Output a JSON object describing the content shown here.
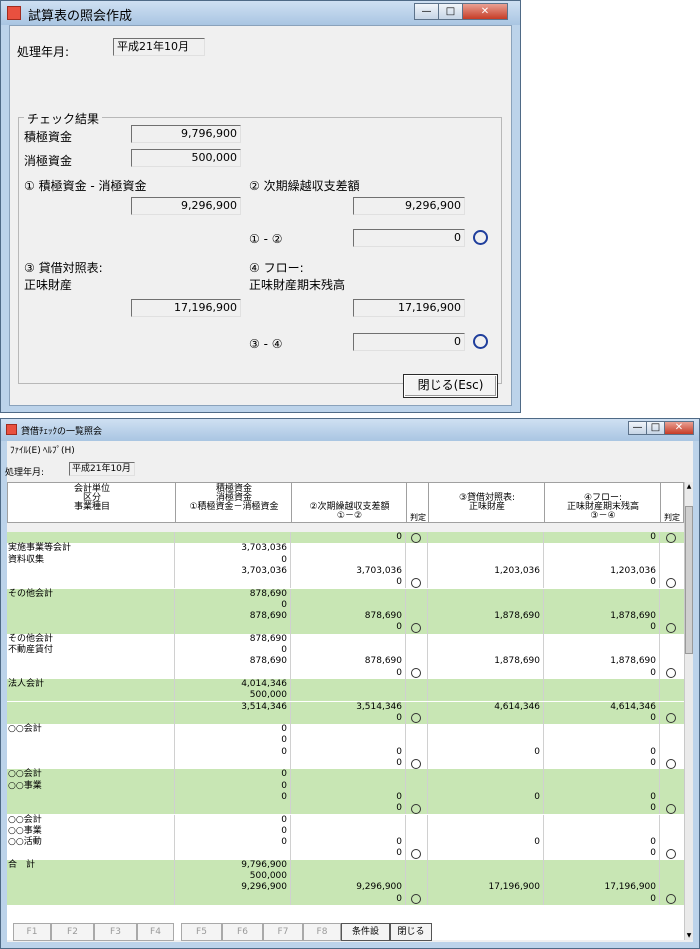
{
  "dialog": {
    "title": "試算表の照会作成",
    "period_label": "処理年月:",
    "period_value": "平成21年10月",
    "group_title": "チェック結果",
    "rows": {
      "positive_label": "積極資金",
      "positive_value": "9,796,900",
      "negative_label": "消極資金",
      "negative_value": "500,000",
      "item1_label": "① 積極資金 - 消極資金",
      "item1_value": "9,296,900",
      "item2_label": "② 次期繰越収支差額",
      "item2_value": "9,296,900",
      "diff12_label": "① - ②",
      "diff12_value": "0",
      "item3_label_a": "③ 貸借対照表:",
      "item3_label_b": "正味財産",
      "item3_value": "17,196,900",
      "item4_label_a": "④ フロー:",
      "item4_label_b": "正味財産期末残高",
      "item4_value": "17,196,900",
      "diff34_label": "③ - ④",
      "diff34_value": "0"
    },
    "close_label": "閉じる(Esc)"
  },
  "list_window": {
    "title": "貸借ﾁｪｯｸの一覧照会",
    "menu": [
      "ﾌｧｲﾙ(E)",
      "ﾍﾙﾌﾟ(H)"
    ],
    "period_label": "処理年月:",
    "period_value": "平成21年10月",
    "headers": {
      "c1": [
        "会計単位",
        "区分",
        "事業種目"
      ],
      "c2": [
        "積極資金",
        "消極資金",
        "①積極資金－消極資金"
      ],
      "c3": [
        "②次期繰越収支差額",
        "①－②"
      ],
      "c4": "判定",
      "c5": [
        "③貸借対照表:",
        "正味財産"
      ],
      "c6": [
        "④フロー:",
        "正味財産期末残高",
        "③－④"
      ],
      "c7": "判定"
    },
    "rows": [
      {
        "label": "",
        "c2": "",
        "c3": "0",
        "j1": true,
        "c5": "",
        "c6": "0",
        "j2": true,
        "green": true
      },
      {
        "label": "実施事業等会計",
        "c2": "3,703,036",
        "c3": "",
        "j1": false,
        "c5": "",
        "c6": "",
        "j2": false,
        "green": false
      },
      {
        "label": "資料収集",
        "c2": "0",
        "c3": "",
        "j1": false,
        "c5": "",
        "c6": "",
        "j2": false,
        "green": false
      },
      {
        "label": "",
        "c2": "3,703,036",
        "c3": "3,703,036",
        "j1": false,
        "c5": "1,203,036",
        "c6": "1,203,036",
        "j2": false,
        "green": false
      },
      {
        "label": "",
        "c2": "",
        "c3": "0",
        "j1": true,
        "c5": "",
        "c6": "0",
        "j2": true,
        "green": false
      },
      {
        "label": "その他会計",
        "c2": "878,690",
        "c3": "",
        "j1": false,
        "c5": "",
        "c6": "",
        "j2": false,
        "green": true
      },
      {
        "label": "",
        "c2": "0",
        "c3": "",
        "j1": false,
        "c5": "",
        "c6": "",
        "j2": false,
        "green": true
      },
      {
        "label": "",
        "c2": "878,690",
        "c3": "878,690",
        "j1": false,
        "c5": "1,878,690",
        "c6": "1,878,690",
        "j2": false,
        "green": true
      },
      {
        "label": "",
        "c2": "",
        "c3": "0",
        "j1": true,
        "c5": "",
        "c6": "0",
        "j2": true,
        "green": true
      },
      {
        "label": "その他会計",
        "c2": "878,690",
        "c3": "",
        "j1": false,
        "c5": "",
        "c6": "",
        "j2": false,
        "green": false
      },
      {
        "label": "不動産賃付",
        "c2": "0",
        "c3": "",
        "j1": false,
        "c5": "",
        "c6": "",
        "j2": false,
        "green": false
      },
      {
        "label": "",
        "c2": "878,690",
        "c3": "878,690",
        "j1": false,
        "c5": "1,878,690",
        "c6": "1,878,690",
        "j2": false,
        "green": false
      },
      {
        "label": "",
        "c2": "",
        "c3": "0",
        "j1": true,
        "c5": "",
        "c6": "0",
        "j2": true,
        "green": false
      },
      {
        "label": "法人会計",
        "c2": "4,014,346",
        "c3": "",
        "j1": false,
        "c5": "",
        "c6": "",
        "j2": false,
        "green": true
      },
      {
        "label": "",
        "c2": "500,000",
        "c3": "",
        "j1": false,
        "c5": "",
        "c6": "",
        "j2": false,
        "green": true
      },
      {
        "label": "",
        "c2": "3,514,346",
        "c3": "3,514,346",
        "j1": false,
        "c5": "4,614,346",
        "c6": "4,614,346",
        "j2": false,
        "green": true
      },
      {
        "label": "",
        "c2": "",
        "c3": "0",
        "j1": true,
        "c5": "",
        "c6": "0",
        "j2": true,
        "green": true
      },
      {
        "label": "○○会計",
        "c2": "0",
        "c3": "",
        "j1": false,
        "c5": "",
        "c6": "",
        "j2": false,
        "green": false
      },
      {
        "label": "",
        "c2": "0",
        "c3": "",
        "j1": false,
        "c5": "",
        "c6": "",
        "j2": false,
        "green": false
      },
      {
        "label": "",
        "c2": "0",
        "c3": "0",
        "j1": false,
        "c5": "0",
        "c6": "0",
        "j2": false,
        "green": false
      },
      {
        "label": "",
        "c2": "",
        "c3": "0",
        "j1": true,
        "c5": "",
        "c6": "0",
        "j2": true,
        "green": false
      },
      {
        "label": "○○会計",
        "c2": "0",
        "c3": "",
        "j1": false,
        "c5": "",
        "c6": "",
        "j2": false,
        "green": true
      },
      {
        "label": "○○事業",
        "c2": "0",
        "c3": "",
        "j1": false,
        "c5": "",
        "c6": "",
        "j2": false,
        "green": true
      },
      {
        "label": "",
        "c2": "0",
        "c3": "0",
        "j1": false,
        "c5": "0",
        "c6": "0",
        "j2": false,
        "green": true
      },
      {
        "label": "",
        "c2": "",
        "c3": "0",
        "j1": true,
        "c5": "",
        "c6": "0",
        "j2": true,
        "green": true
      },
      {
        "label": "○○会計",
        "c2": "0",
        "c3": "",
        "j1": false,
        "c5": "",
        "c6": "",
        "j2": false,
        "green": false
      },
      {
        "label": "○○事業",
        "c2": "0",
        "c3": "",
        "j1": false,
        "c5": "",
        "c6": "",
        "j2": false,
        "green": false
      },
      {
        "label": "○○活動",
        "c2": "0",
        "c3": "0",
        "j1": false,
        "c5": "0",
        "c6": "0",
        "j2": false,
        "green": false
      },
      {
        "label": "",
        "c2": "",
        "c3": "0",
        "j1": true,
        "c5": "",
        "c6": "0",
        "j2": true,
        "green": false
      },
      {
        "label": "合　計",
        "c2": "9,796,900",
        "c3": "",
        "j1": false,
        "c5": "",
        "c6": "",
        "j2": false,
        "green": true
      },
      {
        "label": "",
        "c2": "500,000",
        "c3": "",
        "j1": false,
        "c5": "",
        "c6": "",
        "j2": false,
        "green": true
      },
      {
        "label": "",
        "c2": "9,296,900",
        "c3": "9,296,900",
        "j1": false,
        "c5": "17,196,900",
        "c6": "17,196,900",
        "j2": false,
        "green": true
      },
      {
        "label": "",
        "c2": "",
        "c3": "0",
        "j1": true,
        "c5": "",
        "c6": "0",
        "j2": true,
        "green": true
      }
    ],
    "fkeys": [
      "F1",
      "F2",
      "F3",
      "F4",
      "F5",
      "F6",
      "F7",
      "F8",
      "条件設",
      "閉じる"
    ],
    "colors": {
      "row_green": "#c8e6b4",
      "row_white": "#ffffff"
    }
  }
}
